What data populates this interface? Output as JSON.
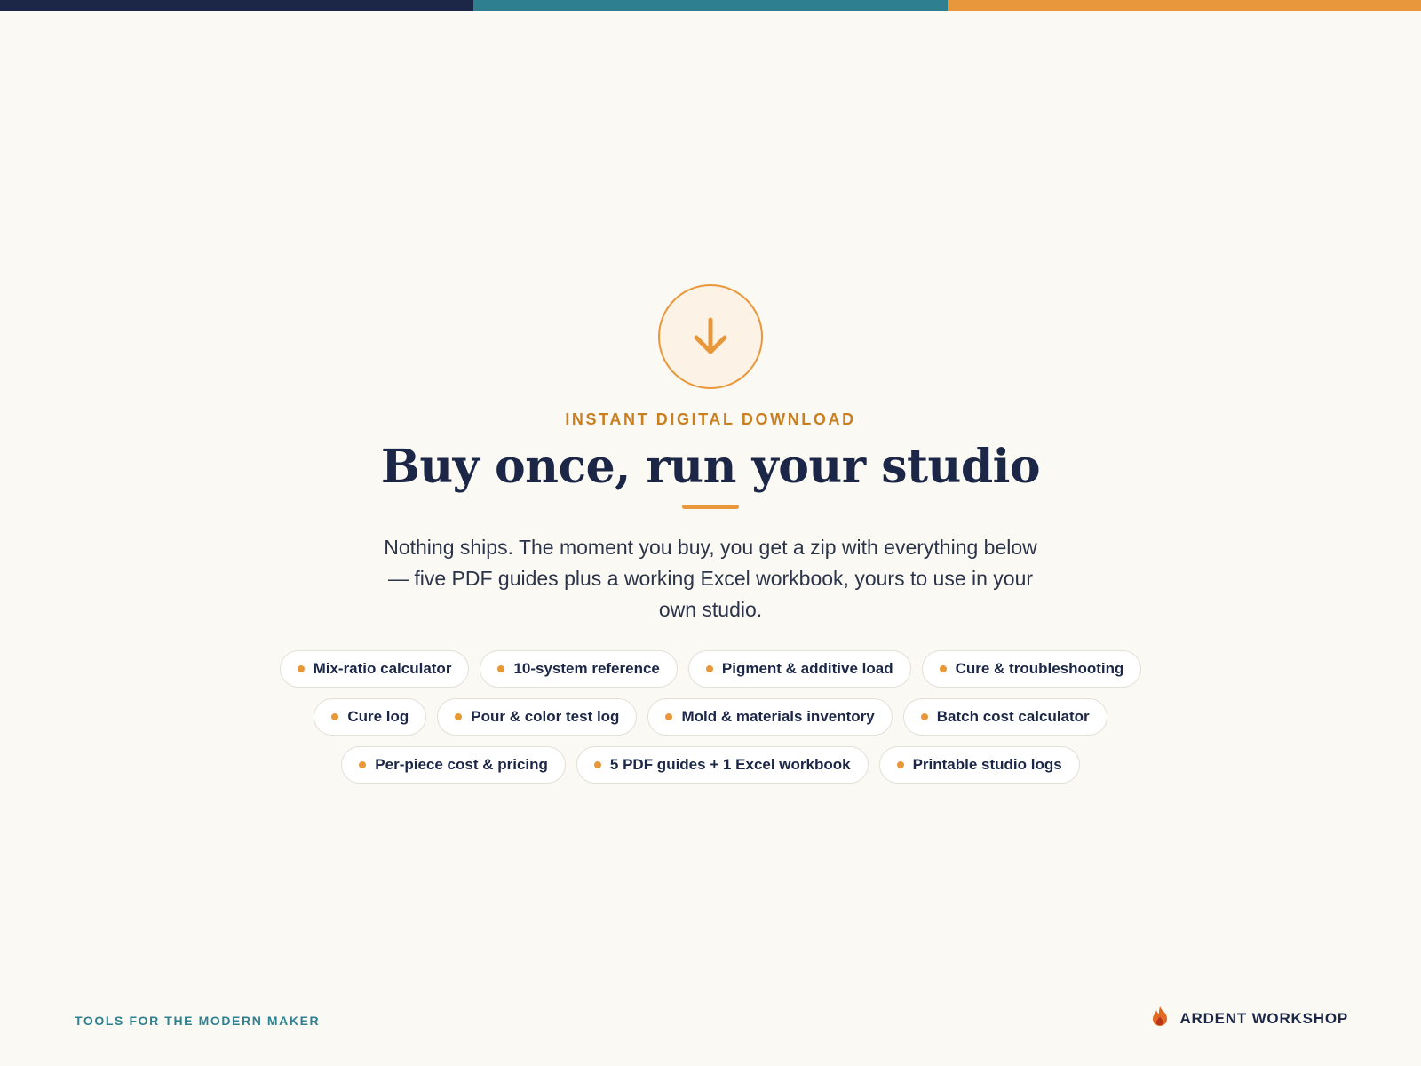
{
  "colors": {
    "navy": "#1c2747",
    "teal": "#2e8090",
    "orange": "#e8983a",
    "background": "#fbf9f3"
  },
  "hero": {
    "icon": "download-arrow-icon",
    "eyebrow": "INSTANT DIGITAL DOWNLOAD",
    "title": "Buy once, run your studio",
    "description": "Nothing ships. The moment you buy, you get a zip with everything below — five PDF guides plus a working Excel workbook, yours to use in your own studio."
  },
  "features": [
    "Mix-ratio calculator",
    "10-system reference",
    "Pigment & additive load",
    "Cure & troubleshooting",
    "Cure log",
    "Pour & color test log",
    "Mold & materials inventory",
    "Batch cost calculator",
    "Per-piece cost & pricing",
    "5 PDF guides + 1 Excel workbook",
    "Printable studio logs"
  ],
  "footer": {
    "tagline": "TOOLS FOR THE MODERN MAKER",
    "brand_icon": "flame-icon",
    "brand_name": "ARDENT WORKSHOP"
  }
}
